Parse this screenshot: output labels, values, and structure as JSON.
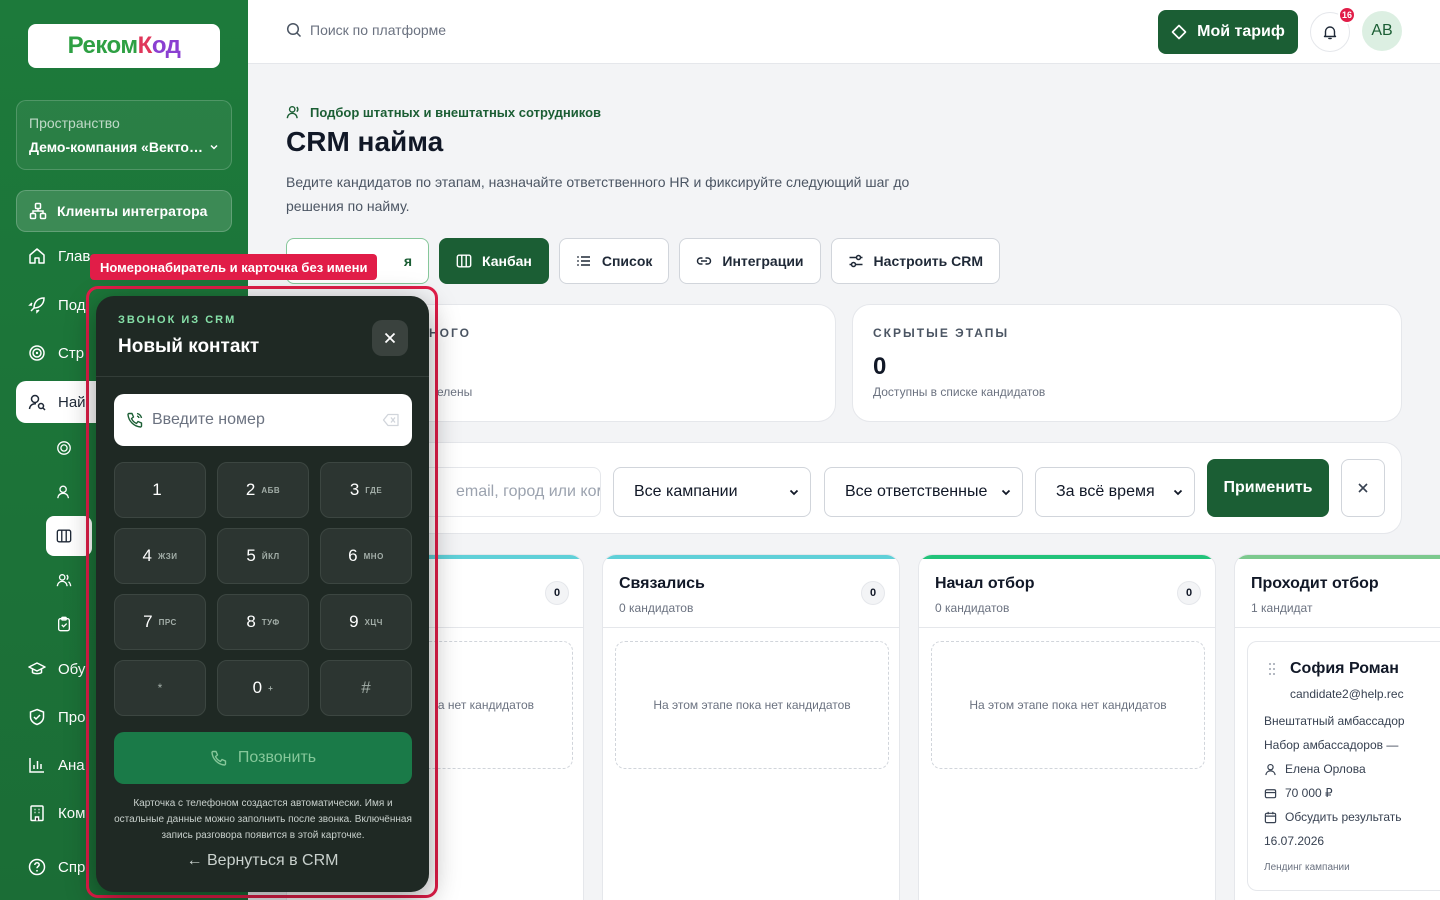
{
  "logo": {
    "part1": "Реком",
    "part2": "К",
    "part3": "од"
  },
  "sidebar": {
    "space_caption": "Пространство",
    "space_value": "Демо-компания «Векто…",
    "clients_label": "Клиенты интегратора",
    "items": [
      {
        "label": "Глав"
      },
      {
        "label": "Под"
      },
      {
        "label": "Стр"
      },
      {
        "label": "Най"
      },
      {
        "label": "Обу"
      },
      {
        "label": "Про"
      },
      {
        "label": "Ана"
      },
      {
        "label": "Ком"
      },
      {
        "label": "Спр"
      }
    ]
  },
  "topbar": {
    "search_placeholder": "Поиск по платформе",
    "plan_label": "Мой тариф",
    "notifications_count": "16",
    "avatar_initials": "AB"
  },
  "page": {
    "eyebrow": "Подбор штатных и внештатных сотрудников",
    "title": "CRM найма",
    "description": "Ведите кандидатов по этапам, назначайте ответственного HR и фиксируйте следующий шаг до решения по найму.",
    "tabs": [
      {
        "label": "я"
      },
      {
        "label": "Канбан"
      },
      {
        "label": "Список"
      },
      {
        "label": "Интеграции"
      },
      {
        "label": "Настроить CRM"
      }
    ]
  },
  "stats": [
    {
      "caption": "НОГО",
      "value": "",
      "sub": "елены"
    },
    {
      "caption": "СКРЫТЫЕ ЭТАПЫ",
      "value": "0",
      "sub": "Доступны в списке кандидатов"
    }
  ],
  "filters": {
    "search_placeholder": "email, город или ком",
    "campaign": "Все кампании",
    "responsible": "Все ответственные",
    "period": "За всё время",
    "apply_label": "Применить"
  },
  "columns": [
    {
      "title": "",
      "count_text": "",
      "badge": "0",
      "empty_text": "а нет кандидатов",
      "accent": "#5fd0d8"
    },
    {
      "title": "Связались",
      "count_text": "0 кандидатов",
      "badge": "0",
      "empty_text": "На этом этапе пока нет кандидатов",
      "accent": "#5fd0d8"
    },
    {
      "title": "Начал отбор",
      "count_text": "0 кандидатов",
      "badge": "0",
      "empty_text": "На этом этапе пока нет кандидатов",
      "accent": "#22c37a"
    },
    {
      "title": "Проходит отбор",
      "count_text": "1 кандидат",
      "badge": "",
      "empty_text": "",
      "accent": "#7cc98e"
    }
  ],
  "candidate_card": {
    "name": "София Роман",
    "email": "candidate2@help.rec",
    "role": "Внештатный амбассадор",
    "campaign": "Набор амбассадоров —",
    "owner": "Елена Орлова",
    "salary": "70 000 ₽",
    "next_step": "Обсудить результать",
    "date": "16.07.2026",
    "source": "Лендинг кампании"
  },
  "annotation": {
    "label": "Номеронабиратель и карточка без имени",
    "color": "#e11d48"
  },
  "dialer": {
    "caption": "ЗВОНОК ИЗ CRM",
    "title": "Новый контакт",
    "input_placeholder": "Введите номер",
    "keys": [
      {
        "digit": "1",
        "letters": ""
      },
      {
        "digit": "2",
        "letters": "АБВ"
      },
      {
        "digit": "3",
        "letters": "ГДЕ"
      },
      {
        "digit": "4",
        "letters": "ЖЗИ"
      },
      {
        "digit": "5",
        "letters": "ЙКЛ"
      },
      {
        "digit": "6",
        "letters": "МНО"
      },
      {
        "digit": "7",
        "letters": "ПРС"
      },
      {
        "digit": "8",
        "letters": "ТУФ"
      },
      {
        "digit": "9",
        "letters": "ХЦЧ"
      },
      {
        "digit": "*",
        "letters": ""
      },
      {
        "digit": "0",
        "letters": "+"
      },
      {
        "digit": "#",
        "letters": ""
      }
    ],
    "call_label": "Позвонить",
    "note": "Карточка с телефоном создастся автоматически. Имя и остальные данные можно заполнить после звонка. Включённая запись разговора появится в этой карточке.",
    "back_label": "← Вернуться в CRM"
  },
  "colors": {
    "brand": "#1b5e34",
    "sidebar": "#1d7a3b",
    "alert": "#e11d48"
  }
}
